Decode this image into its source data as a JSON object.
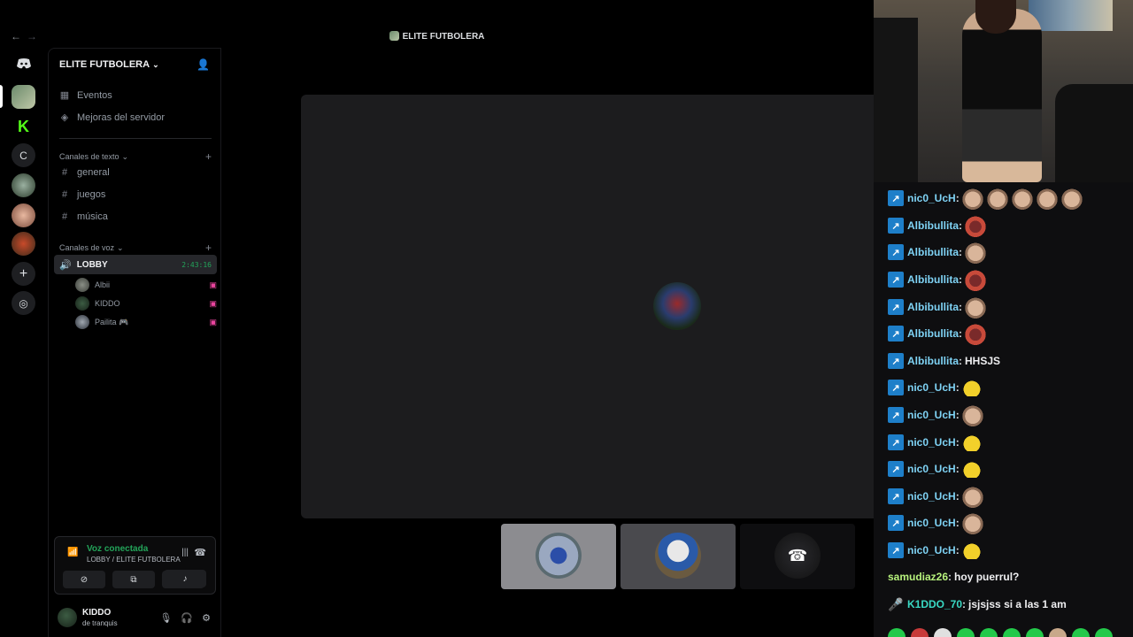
{
  "window": {
    "title": "ELITE FUTBOLERA"
  },
  "colors": {
    "accent_green": "#23a55a",
    "stream_pink": "#eb459f",
    "chat_badge_blue": "#1e7fc9"
  },
  "rail": {
    "items": [
      {
        "icon": "discord-icon"
      },
      {
        "icon": "server-elite-futbolera"
      },
      {
        "icon": "server-k"
      },
      {
        "label": "C"
      },
      {
        "icon": "server-avatar-1"
      },
      {
        "icon": "server-avatar-2"
      },
      {
        "icon": "server-avatar-3"
      },
      {
        "icon": "add-server-icon"
      },
      {
        "icon": "explore-icon"
      }
    ]
  },
  "sidebar": {
    "server_name": "ELITE FUTBOLERA",
    "top_items": [
      {
        "label": "Eventos",
        "icon": "calendar-icon"
      },
      {
        "label": "Mejoras del servidor",
        "icon": "boost-icon"
      }
    ],
    "text_category": "Canales de texto",
    "text_channels": [
      "general",
      "juegos",
      "música"
    ],
    "voice_category": "Canales de voz",
    "voice_channel": {
      "name": "LOBBY",
      "timer": "2:43:16"
    },
    "voice_users": [
      {
        "name": "Albii"
      },
      {
        "name": "KIDDO"
      },
      {
        "name": "Pailita 🎮"
      }
    ]
  },
  "voice_panel": {
    "status": "Voz conectada",
    "location": "LOBBY / ELITE FUTBOLERA"
  },
  "user_panel": {
    "username": "KIDDO",
    "status": "de tranquis"
  },
  "chat": {
    "messages": [
      {
        "user": "nic0_UcH",
        "text": "",
        "emotes": [
          "cat",
          "cat",
          "cat",
          "cat",
          "cat"
        ]
      },
      {
        "user": "Albibullita",
        "text": "",
        "emotes": [
          "bear"
        ]
      },
      {
        "user": "Albibullita",
        "text": "",
        "emotes": [
          "cat"
        ]
      },
      {
        "user": "Albibullita",
        "text": "",
        "emotes": [
          "bear"
        ]
      },
      {
        "user": "Albibullita",
        "text": "",
        "emotes": [
          "cat"
        ]
      },
      {
        "user": "Albibullita",
        "text": "",
        "emotes": [
          "bear"
        ]
      },
      {
        "user": "Albibullita",
        "text": "HHSJS",
        "emotes": []
      },
      {
        "user": "nic0_UcH",
        "text": "",
        "emotes": [
          "pop"
        ]
      },
      {
        "user": "nic0_UcH",
        "text": "",
        "emotes": [
          "cat"
        ]
      },
      {
        "user": "nic0_UcH",
        "text": "",
        "emotes": [
          "pop"
        ]
      },
      {
        "user": "nic0_UcH",
        "text": "",
        "emotes": [
          "pop"
        ]
      },
      {
        "user": "nic0_UcH",
        "text": "",
        "emotes": [
          "cat"
        ]
      },
      {
        "user": "nic0_UcH",
        "text": "",
        "emotes": [
          "cat"
        ]
      },
      {
        "user": "nic0_UcH",
        "text": "",
        "emotes": [
          "pop"
        ]
      },
      {
        "user": "samudiaz26",
        "text": "hoy puerrul?",
        "emotes": []
      },
      {
        "user": "K1DDO_70",
        "text": "jsjsjss si a las 1 am",
        "emotes": []
      }
    ]
  }
}
